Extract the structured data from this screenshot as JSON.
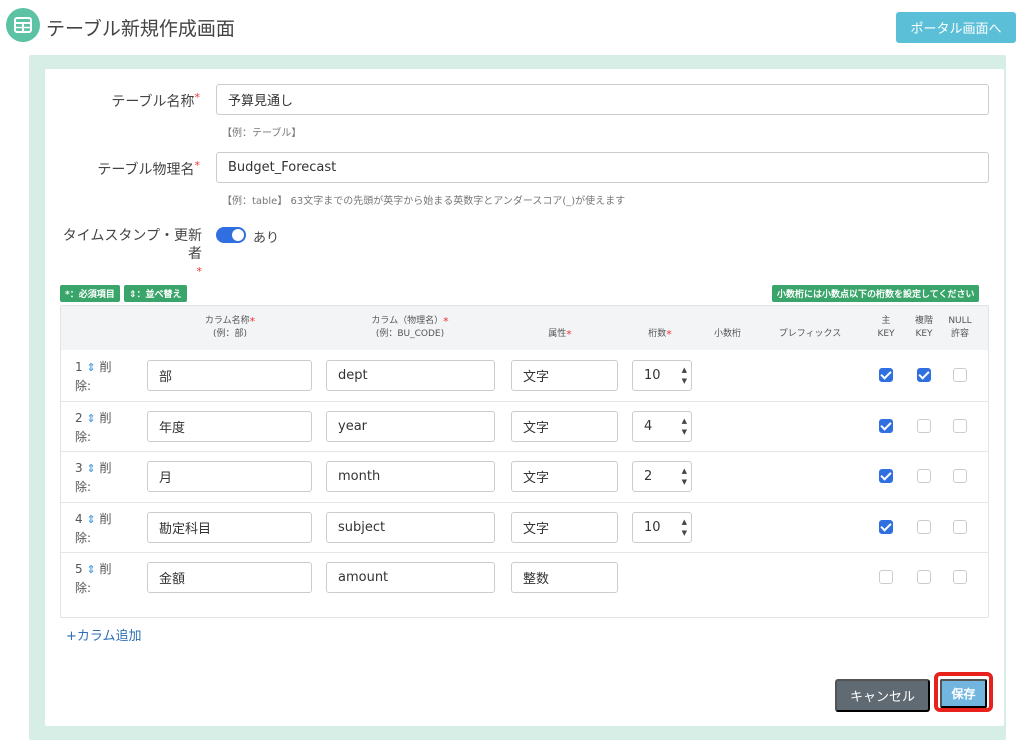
{
  "header": {
    "title": "テーブル新規作成画面",
    "portal_button": "ポータル画面へ"
  },
  "form": {
    "table_name_label": "テーブル名称",
    "table_name_value": "予算見通し",
    "table_name_hint": "【例：テーブル】",
    "physical_name_label": "テーブル物理名",
    "physical_name_value": "Budget_Forecast",
    "physical_name_hint": "【例：table】 63文字までの先頭が英字から始まる英数字とアンダースコア(_)が使えます",
    "timestamp_label": "タイムスタンプ・更新者",
    "timestamp_toggle_text": "あり",
    "timestamp_enabled": true,
    "required_mark": "*"
  },
  "badges": {
    "required_legend": "*：必須項目",
    "sort_legend": "⇕：並べ替え",
    "decimal_note": "小数桁には小数点以下の桁数を設定してください"
  },
  "table": {
    "headers": {
      "col_name": "カラム名称",
      "col_name_example": "(例：部)",
      "col_physical": "カラム（物理名）",
      "col_physical_example": "(例：BU_CODE)",
      "attr": "属性",
      "digits": "桁数",
      "decimal": "小数桁",
      "prefix": "プレフィックス",
      "pk_1": "主",
      "pk_2": "KEY",
      "rk_1": "複階",
      "rk_2": "KEY",
      "null_1": "NULL",
      "null_2": "許容"
    },
    "rows": [
      {
        "num": "1",
        "delete": "削",
        "delete2": "除:",
        "name": "部",
        "physical": "dept",
        "attr": "文字",
        "digits": "10",
        "pk": true,
        "rk": true,
        "nullable": false
      },
      {
        "num": "2",
        "delete": "削",
        "delete2": "除:",
        "name": "年度",
        "physical": "year",
        "attr": "文字",
        "digits": "4",
        "pk": true,
        "rk": false,
        "nullable": false
      },
      {
        "num": "3",
        "delete": "削",
        "delete2": "除:",
        "name": "月",
        "physical": "month",
        "attr": "文字",
        "digits": "2",
        "pk": true,
        "rk": false,
        "nullable": false
      },
      {
        "num": "4",
        "delete": "削",
        "delete2": "除:",
        "name": "勘定科目",
        "physical": "subject",
        "attr": "文字",
        "digits": "10",
        "pk": true,
        "rk": false,
        "nullable": false
      },
      {
        "num": "5",
        "delete": "削",
        "delete2": "除:",
        "name": "金額",
        "physical": "amount",
        "attr": "整数",
        "digits": null,
        "pk": false,
        "rk": false,
        "nullable": false
      }
    ]
  },
  "actions": {
    "add_column": "+カラム追加",
    "cancel": "キャンセル",
    "save": "保存"
  },
  "colors": {
    "accent_green": "#5bc2a4",
    "badge_green": "#3aa56a",
    "primary_blue": "#2f6fe0",
    "save_highlight": "#e8211d"
  }
}
